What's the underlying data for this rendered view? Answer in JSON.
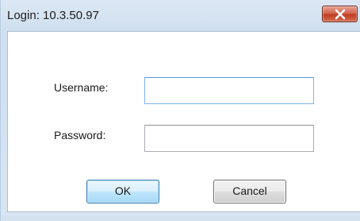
{
  "window": {
    "title": "Login: 10.3.50.97",
    "close_icon": "close-icon"
  },
  "form": {
    "username_label": "Username:",
    "username_value": "",
    "password_label": "Password:",
    "password_value": ""
  },
  "buttons": {
    "ok_label": "OK",
    "cancel_label": "Cancel"
  },
  "colors": {
    "title_bar": "#cfdfef",
    "close_button": "#c64a30",
    "ok_button_border": "#3c7fb1",
    "focused_field_border": "#7eb4ea"
  }
}
